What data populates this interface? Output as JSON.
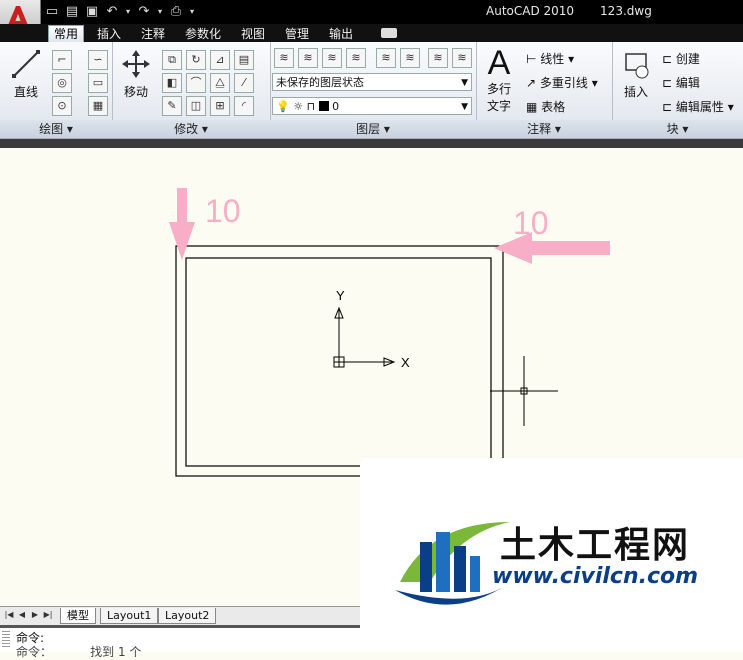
{
  "title": {
    "app_name": "AutoCAD 2010",
    "file_name": "123.dwg"
  },
  "tabs": [
    {
      "label": "常用",
      "active": true
    },
    {
      "label": "插入"
    },
    {
      "label": "注释"
    },
    {
      "label": "参数化"
    },
    {
      "label": "视图"
    },
    {
      "label": "管理"
    },
    {
      "label": "输出"
    }
  ],
  "panels": {
    "draw": {
      "title": "绘图",
      "line_label": "直线"
    },
    "modify": {
      "title": "修改",
      "move_label": "移动"
    },
    "layers": {
      "title": "图层",
      "layer_state": "未保存的图层状态",
      "current_layer": "0"
    },
    "annotation": {
      "title": "注释",
      "mtext_label_1": "多行",
      "mtext_label_2": "文字",
      "linear_label": "线性",
      "multileader_label": "多重引线",
      "table_label": "表格"
    },
    "block": {
      "title": "块",
      "insert_label": "插入",
      "create_label": "创建",
      "edit_label": "编辑",
      "edit_attr_label": "编辑属性"
    }
  },
  "drawing": {
    "annotation_top": "10",
    "annotation_right": "10",
    "ucs_y": "Y",
    "ucs_x": "X",
    "arrow_color": "#f7aec6"
  },
  "layout_tabs": [
    {
      "label": "模型",
      "active": true
    },
    {
      "label": "Layout1"
    },
    {
      "label": "Layout2"
    }
  ],
  "command": {
    "prompt": "命令:",
    "history": "命令：          找到 1 个"
  },
  "watermark": {
    "title": "土木工程网",
    "url": "www.civilcn.com"
  },
  "colors": {
    "brand_red": "#c8201c",
    "ribbon_bg": "#e6ebf1",
    "canvas_bg": "#fcfcf2",
    "watermark_blue": "#0a3e87",
    "watermark_green": "#7bb83a"
  }
}
